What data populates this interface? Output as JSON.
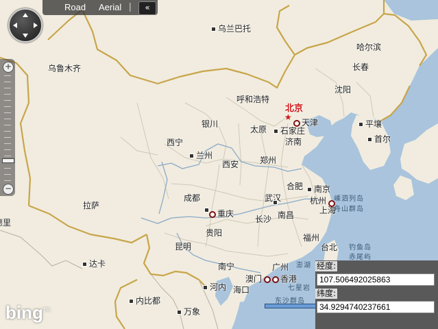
{
  "nav": {
    "road": "Road",
    "aerial": "Aerial",
    "separator": "|",
    "collapse": "«"
  },
  "zoom": {
    "in": "+",
    "out": "−"
  },
  "logo": {
    "text": "bing",
    "tm": "TM"
  },
  "coords": {
    "lng_label": "经度:",
    "lng_value": "107.506492025863",
    "lat_label": "纬度:",
    "lat_value": "34.9294740237661"
  },
  "cities": {
    "ulaanbaatar": "乌兰巴托",
    "harbin": "哈尔滨",
    "changchun": "长春",
    "urumqi": "乌鲁木齐",
    "hohhot": "呼和浩特",
    "shenyang": "沈阳",
    "beijing": "北京",
    "tianjin": "天津",
    "pingrang": "平壤",
    "yinchuan": "银川",
    "taiyuan": "太原",
    "shijiazhuang": "石家庄",
    "jinan": "济南",
    "seoul": "首尔",
    "xining": "西宁",
    "lanzhou": "兰州",
    "zhengzhou": "郑州",
    "xian": "西安",
    "hefei": "合肥",
    "nanjing": "南京",
    "lasa": "拉萨",
    "chengdu": "成都",
    "wuhan": "武汉",
    "hangzhou": "杭州",
    "shanghai": "上海",
    "chongqing": "重庆",
    "changsha": "长沙",
    "nanchang": "南昌",
    "guiyang": "贵阳",
    "fuzhou": "福州",
    "kunming": "昆明",
    "taibei": "台北",
    "nanning": "南宁",
    "guangzhou": "广州",
    "dhaka": "达卡",
    "aomen": "澳门",
    "xianggang": "香港",
    "hanoi": "河内",
    "haikou": "海口",
    "naypyidaw": "内比都",
    "vientiane": "万象",
    "partial_west": "德里"
  },
  "sea_labels": {
    "shengsi": "嵊泗列岛",
    "zhoushan": "舟山群岛",
    "diaoyu": "钓鱼岛",
    "chiwei": "赤尾屿",
    "penghu": "澎湖",
    "dongsha": "东沙群岛",
    "qixing": "七星岩"
  },
  "colors": {
    "land": "#f1ecdf",
    "sea": "#a9c4dc",
    "national_border": "#c8a54a",
    "province_border": "#c9c2b3",
    "river": "#8aa9c8",
    "capital": "#d01616"
  }
}
